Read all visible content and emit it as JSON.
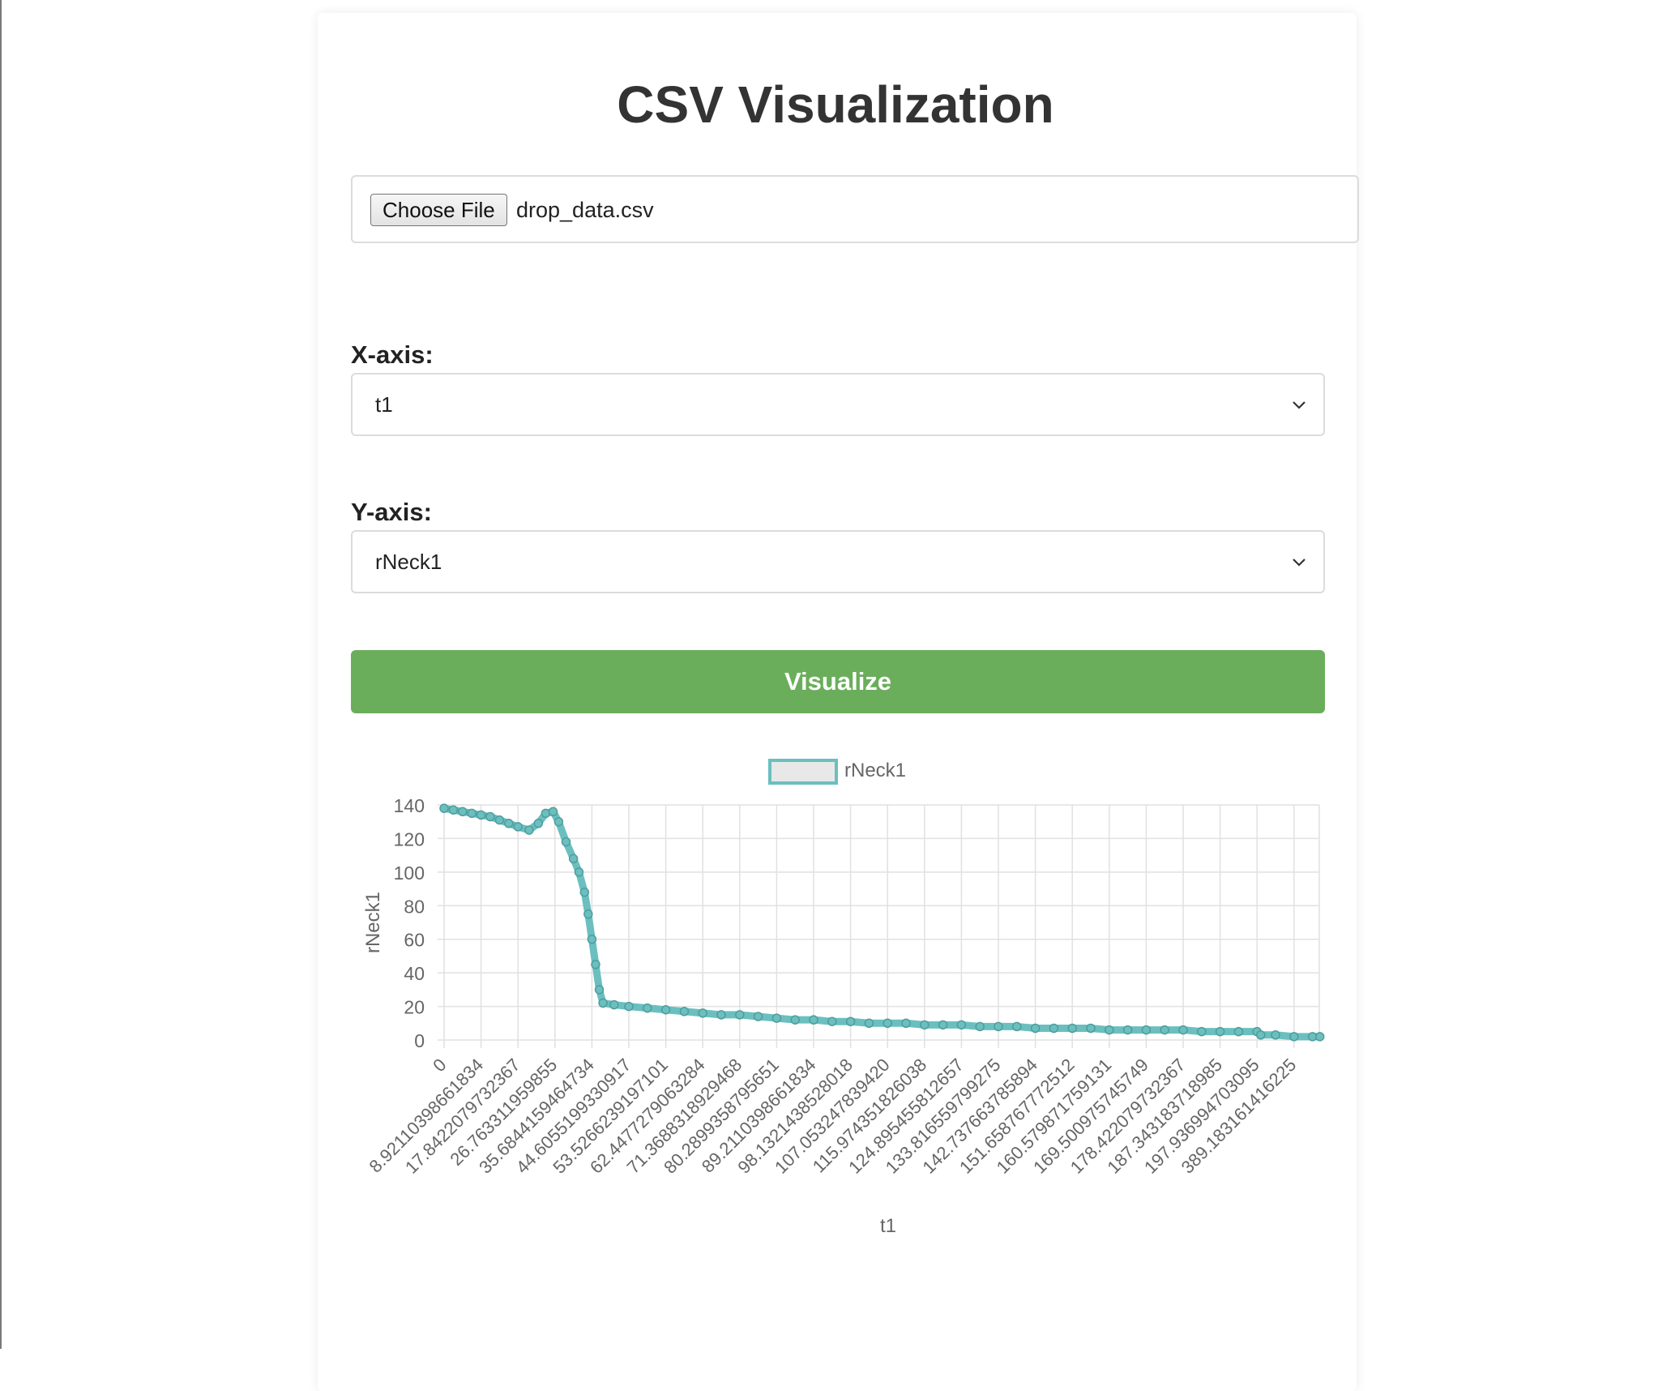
{
  "page": {
    "title": "CSV Visualization"
  },
  "file_input": {
    "button_label": "Choose File",
    "file_name": "drop_data.csv"
  },
  "x_axis": {
    "label": "X-axis:",
    "selected": "t1"
  },
  "y_axis": {
    "label": "Y-axis:",
    "selected": "rNeck1"
  },
  "visualize_button": "Visualize",
  "colors": {
    "button_green": "#6aae5b",
    "series_teal": "#6bbfbf",
    "title_text": "#333333"
  },
  "chart_data": {
    "type": "line",
    "legend": [
      "rNeck1"
    ],
    "legend_position": "top",
    "xlabel": "t1",
    "ylabel": "rNeck1",
    "ylim": [
      0,
      140
    ],
    "y_ticks": [
      0,
      20,
      40,
      60,
      80,
      100,
      120,
      140
    ],
    "grid": true,
    "x_tick_labels": [
      "0",
      "8.92110398661834",
      "17.8422079732367",
      "26.763311959855",
      "35.6844159464734",
      "44.6055199330917",
      "53.5266239197101",
      "62.4477279063284",
      "71.3688318929468",
      "80.2899358795651",
      "89.2110398661834",
      "98.1321438528018",
      "107.053247839420",
      "115.974351826038",
      "124.895455812657",
      "133.816559799275",
      "142.737663785894",
      "151.658767772512",
      "160.579871759131",
      "169.500975745749",
      "178.422079732367",
      "187.343183718985",
      "197.936994703095",
      "389.183161416225"
    ],
    "series": [
      {
        "name": "rNeck1",
        "values": [
          [
            0,
            138
          ],
          [
            0.25,
            137
          ],
          [
            0.5,
            136
          ],
          [
            0.75,
            135
          ],
          [
            1.0,
            134
          ],
          [
            1.25,
            133
          ],
          [
            1.5,
            131
          ],
          [
            1.75,
            129
          ],
          [
            2.0,
            127
          ],
          [
            2.3,
            125
          ],
          [
            2.55,
            129
          ],
          [
            2.75,
            135
          ],
          [
            2.95,
            136
          ],
          [
            3.1,
            130
          ],
          [
            3.3,
            118
          ],
          [
            3.5,
            108
          ],
          [
            3.65,
            100
          ],
          [
            3.8,
            88
          ],
          [
            3.9,
            75
          ],
          [
            4.0,
            60
          ],
          [
            4.1,
            45
          ],
          [
            4.2,
            30
          ],
          [
            4.3,
            22
          ],
          [
            4.6,
            21
          ],
          [
            5.0,
            20
          ],
          [
            5.5,
            19
          ],
          [
            6.0,
            18
          ],
          [
            6.5,
            17
          ],
          [
            7.0,
            16
          ],
          [
            7.5,
            15
          ],
          [
            8.0,
            15
          ],
          [
            8.5,
            14
          ],
          [
            9.0,
            13
          ],
          [
            9.5,
            12
          ],
          [
            10.0,
            12
          ],
          [
            10.5,
            11
          ],
          [
            11.0,
            11
          ],
          [
            11.5,
            10
          ],
          [
            12.0,
            10
          ],
          [
            12.5,
            10
          ],
          [
            13.0,
            9
          ],
          [
            13.5,
            9
          ],
          [
            14.0,
            9
          ],
          [
            14.5,
            8
          ],
          [
            15.0,
            8
          ],
          [
            15.5,
            8
          ],
          [
            16.0,
            7
          ],
          [
            16.5,
            7
          ],
          [
            17.0,
            7
          ],
          [
            17.5,
            7
          ],
          [
            18.0,
            6
          ],
          [
            18.5,
            6
          ],
          [
            19.0,
            6
          ],
          [
            19.5,
            6
          ],
          [
            20.0,
            6
          ],
          [
            20.5,
            5
          ],
          [
            21.0,
            5
          ],
          [
            21.5,
            5
          ],
          [
            22.0,
            5
          ],
          [
            22.1,
            3
          ],
          [
            22.5,
            3
          ],
          [
            23.0,
            2
          ],
          [
            23.5,
            2
          ],
          [
            23.7,
            2
          ]
        ]
      }
    ]
  }
}
